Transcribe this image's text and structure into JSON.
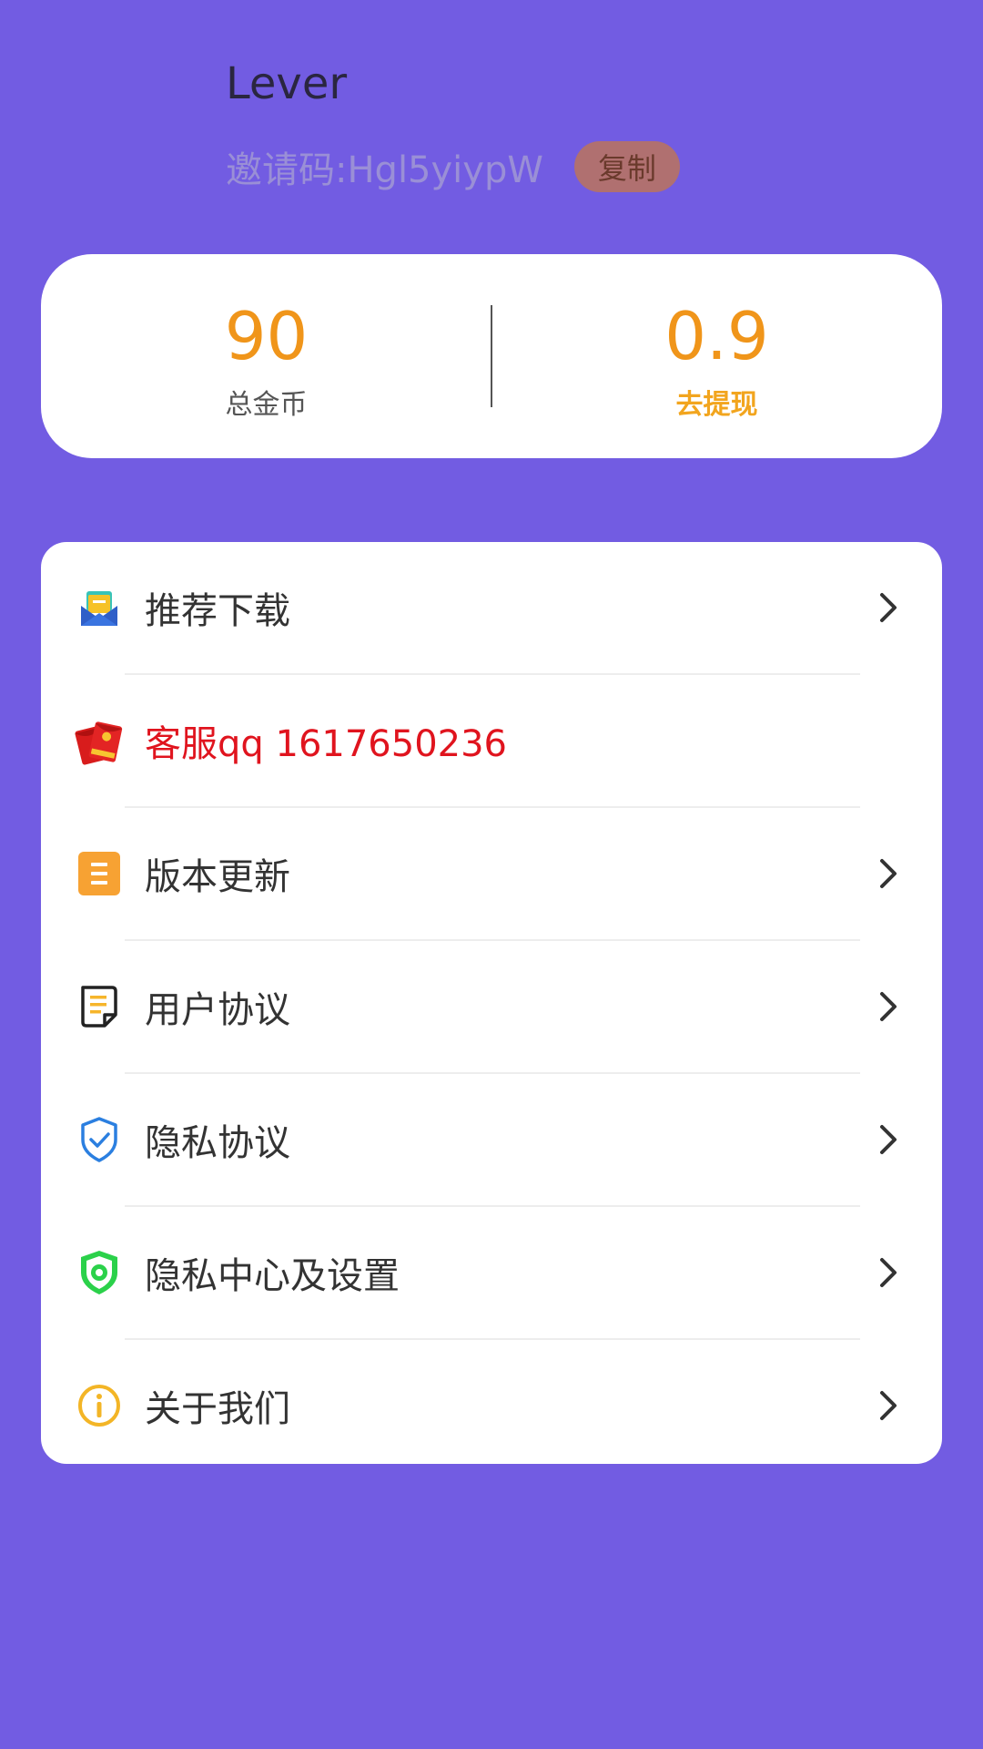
{
  "profile": {
    "username": "Lever",
    "invite_code_label": "邀请码:Hgl5yiypW",
    "copy_label": "复制"
  },
  "stats": {
    "total_coins_value": "90",
    "total_coins_label": "总金币",
    "withdraw_value": "0.9",
    "withdraw_label": "去提现"
  },
  "menu": {
    "items": [
      {
        "label": "推荐下载",
        "icon": "envelope-download-icon",
        "chevron": true
      },
      {
        "label": "客服qq 1617650236",
        "icon": "red-envelope-icon",
        "chevron": false
      },
      {
        "label": "版本更新",
        "icon": "document-update-icon",
        "chevron": true
      },
      {
        "label": "用户协议",
        "icon": "agreement-doc-icon",
        "chevron": true
      },
      {
        "label": "隐私协议",
        "icon": "shield-check-icon",
        "chevron": true
      },
      {
        "label": "隐私中心及设置",
        "icon": "shield-gear-icon",
        "chevron": true
      },
      {
        "label": "关于我们",
        "icon": "info-icon",
        "chevron": true
      }
    ]
  },
  "colors": {
    "background": "#725CE2",
    "accent_orange": "#F0951A",
    "withdraw_yellow": "#F2A51E",
    "service_red": "#E0141E",
    "card": "#FFFFFF"
  }
}
